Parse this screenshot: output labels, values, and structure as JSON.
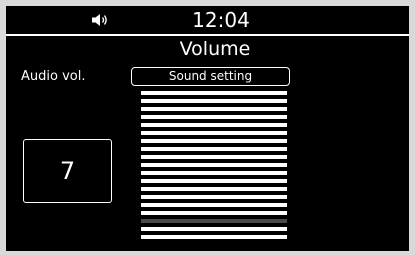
{
  "status_bar": {
    "icon": "speaker-icon",
    "time": "12:04"
  },
  "screen": {
    "title": "Volume"
  },
  "audio": {
    "label": "Audio vol.",
    "value": "7",
    "button_label": "Sound setting"
  },
  "level_meter": {
    "total_bars": 19,
    "highlighted_bar": 16,
    "active_color": "#ffffff",
    "inactive_color": "#4a4a4a"
  }
}
